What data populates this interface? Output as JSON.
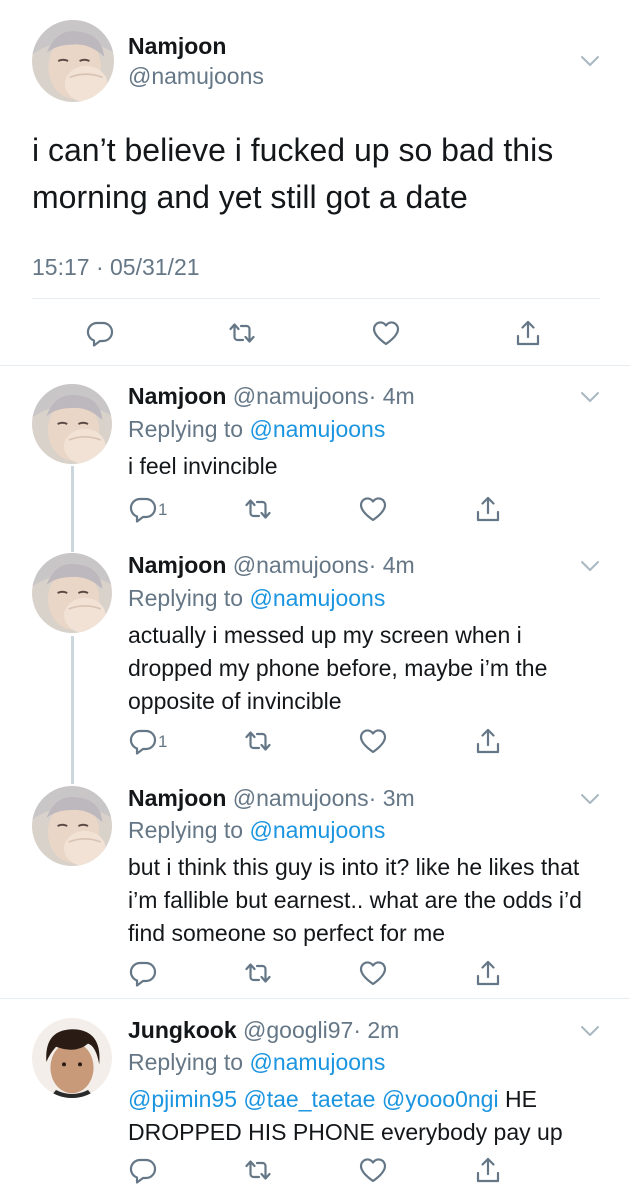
{
  "main_tweet": {
    "name": "Namjoon",
    "handle": "@namujoons",
    "text": "i can’t believe i fucked up so bad this morning and yet still got a date",
    "timestamp": "15:17 · 05/31/21"
  },
  "replies": [
    {
      "name": "Namjoon",
      "handle": "@namujoons",
      "time": "· 4m",
      "replying_prefix": "Replying to",
      "replying_to": "@namujoons",
      "text": "i feel invincible",
      "reply_count": "1"
    },
    {
      "name": "Namjoon",
      "handle": "@namujoons",
      "time": "· 4m",
      "replying_prefix": "Replying to",
      "replying_to": "@namujoons",
      "text": "actually i messed up my screen when i dropped my phone before, maybe i’m the opposite of invincible",
      "reply_count": "1"
    },
    {
      "name": "Namjoon",
      "handle": "@namujoons",
      "time": "· 3m",
      "replying_prefix": "Replying to",
      "replying_to": "@namujoons",
      "text": "but i think this guy is into it? like he likes that i’m fallible but earnest.. what are the odds i’d find someone so perfect for me"
    },
    {
      "name": "Jungkook",
      "handle": "@googli97",
      "time": "· 2m",
      "replying_prefix": "Replying to",
      "replying_to": "@namujoons",
      "mentions": [
        "@pjimin95",
        "@tae_taetae",
        "@yooo0ngi"
      ],
      "text_rest": "HE DROPPED HIS PHONE everybody pay up"
    }
  ],
  "icons": {
    "reply": "reply-icon",
    "retweet": "retweet-icon",
    "like": "heart-icon",
    "share": "share-icon",
    "menu": "chevron-down-icon"
  },
  "colors": {
    "link": "#1b95e0",
    "muted": "#657786",
    "separator": "#e6ecf0"
  }
}
